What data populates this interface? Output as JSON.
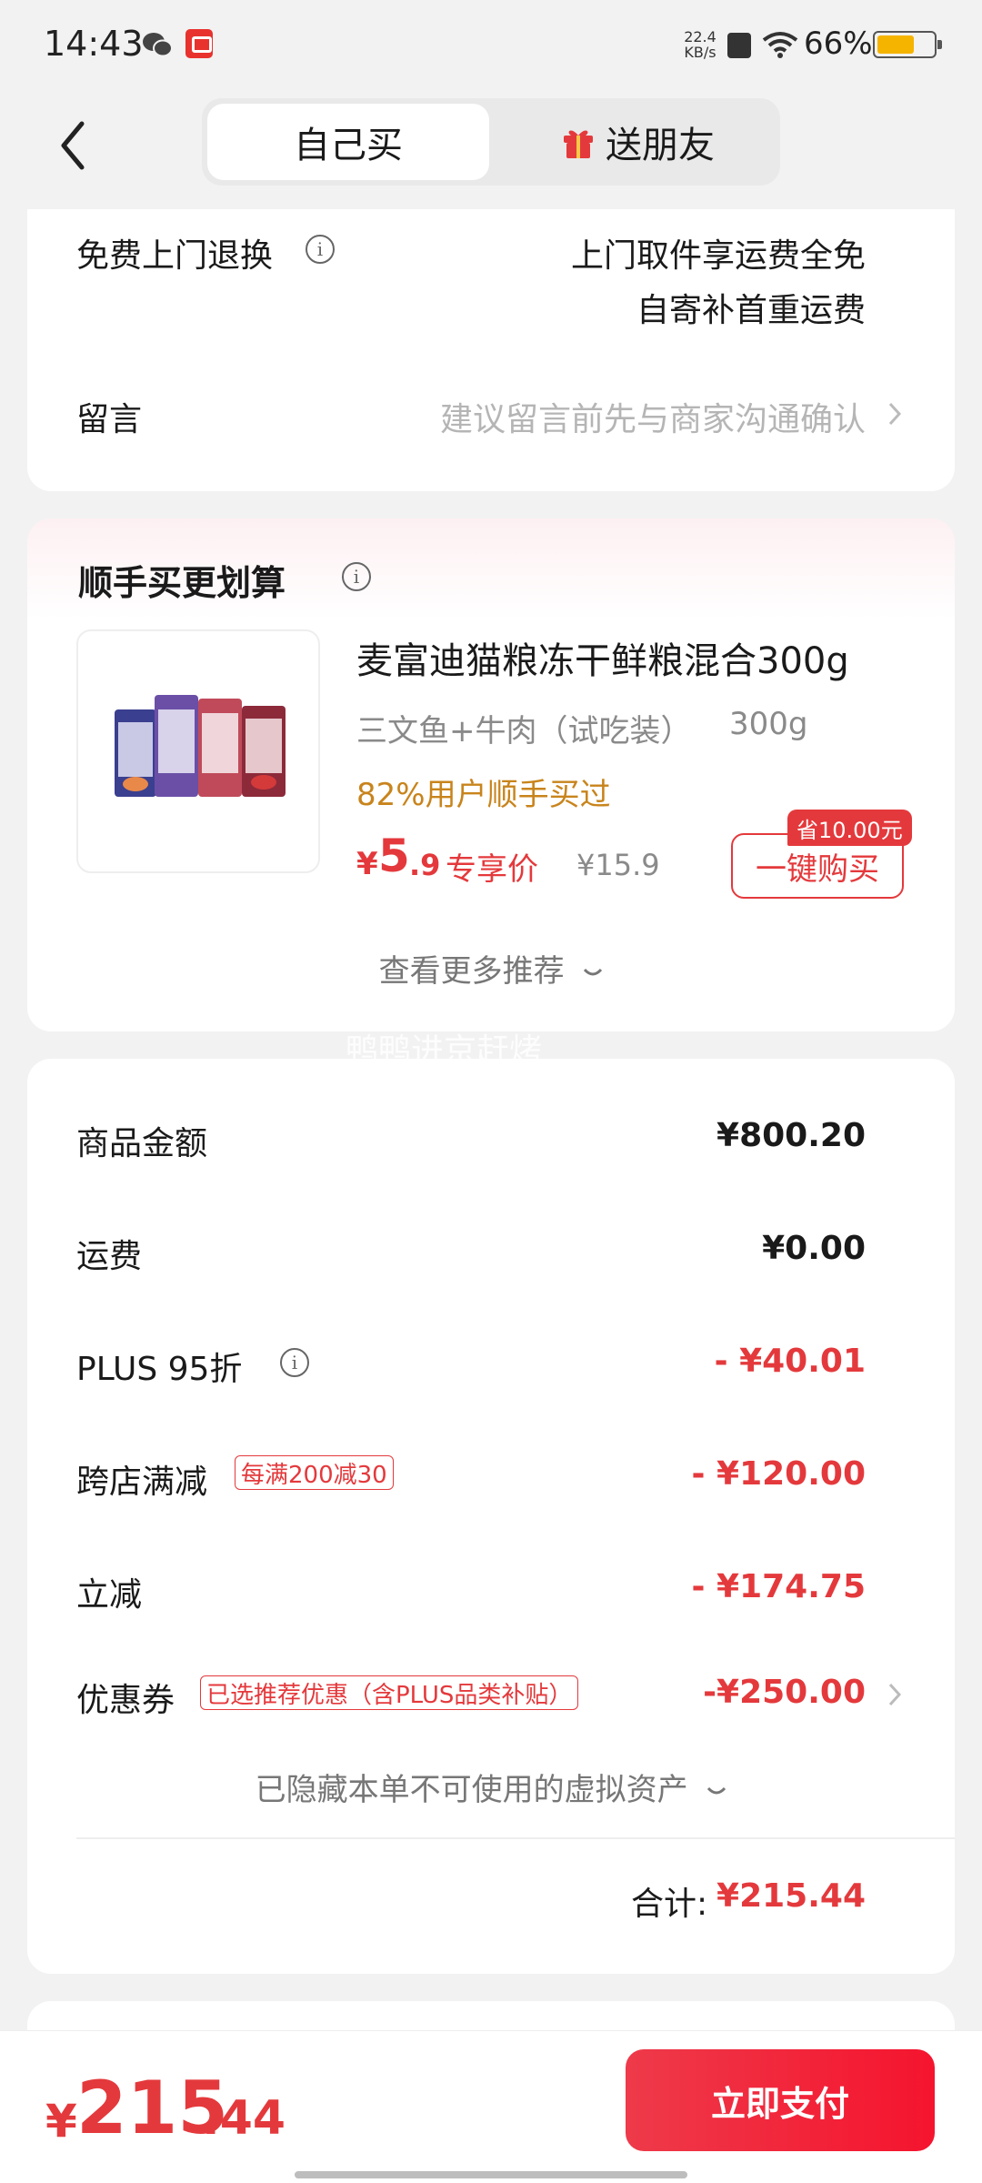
{
  "status_bar": {
    "time": "14:43",
    "net_speed_value": "22.4",
    "net_speed_unit": "KB/s",
    "battery": "66%",
    "battery_level": 0.66
  },
  "header": {
    "tabs": [
      {
        "label": "自己买",
        "selected": true
      },
      {
        "label": "送朋友",
        "selected": false
      }
    ]
  },
  "service": {
    "return_label": "免费上门退换",
    "return_line1": "上门取件享运费全免",
    "return_line2": "自寄补首重运费",
    "note_label": "留言",
    "note_placeholder": "建议留言前先与商家沟通确认"
  },
  "recommend": {
    "title": "顺手买更划算",
    "product_name": "麦富迪猫粮冻干鲜粮混合300g",
    "spec": "三文鱼+牛肉（试吃装）",
    "size": "300g",
    "buyers": "82%用户顺手买过",
    "price_symbol": "¥",
    "price_int": "5",
    "price_dec": ".9",
    "price_tag": "专享价",
    "original_price": "¥15.9",
    "save_badge": "省10.00元",
    "buy_button": "一键购买",
    "more": "查看更多推荐"
  },
  "watermark": "鸭鸭进京赶烤",
  "summary": {
    "rows": [
      {
        "label": "商品金额",
        "value": "¥800.20"
      },
      {
        "label": "运费",
        "value": "¥0.00"
      },
      {
        "label": "PLUS 95折",
        "value": "- ¥40.01"
      },
      {
        "label": "跨店满减",
        "tag": "每满200减30",
        "value": "- ¥120.00"
      },
      {
        "label": "立减",
        "value": "- ¥174.75"
      },
      {
        "label": "优惠券",
        "tag": "已选推荐优惠（含PLUS品类补贴）",
        "value": "-¥250.00"
      }
    ],
    "hidden_assets": "已隐藏本单不可使用的虚拟资产",
    "total_label": "合计:",
    "total_value": "¥215.44"
  },
  "bottom": {
    "price_symbol": "¥",
    "price_int": "215",
    "price_dec": ".44",
    "pay_button": "立即支付"
  },
  "colors": {
    "accent_red": "#e4393c",
    "buyers_orange": "#c8841c",
    "battery": "#f5b400"
  }
}
